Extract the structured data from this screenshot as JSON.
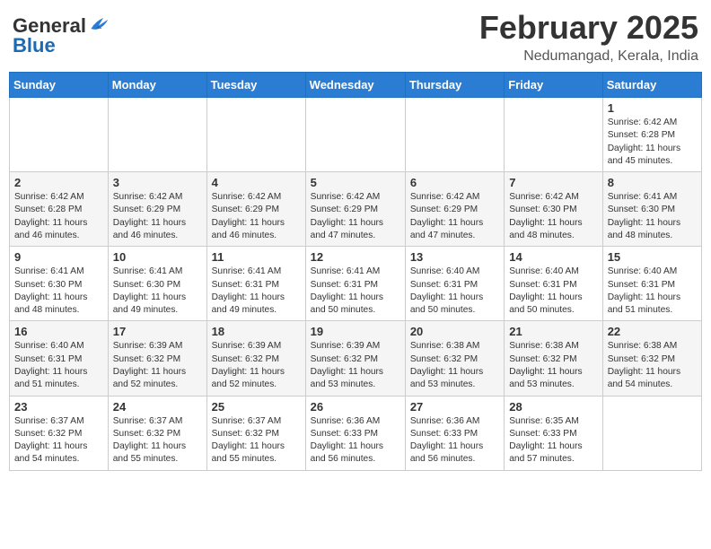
{
  "header": {
    "logo": {
      "general": "General",
      "blue": "Blue"
    },
    "title": "February 2025",
    "location": "Nedumangad, Kerala, India"
  },
  "weekdays": [
    "Sunday",
    "Monday",
    "Tuesday",
    "Wednesday",
    "Thursday",
    "Friday",
    "Saturday"
  ],
  "weeks": [
    [
      {
        "day": "",
        "info": ""
      },
      {
        "day": "",
        "info": ""
      },
      {
        "day": "",
        "info": ""
      },
      {
        "day": "",
        "info": ""
      },
      {
        "day": "",
        "info": ""
      },
      {
        "day": "",
        "info": ""
      },
      {
        "day": "1",
        "info": "Sunrise: 6:42 AM\nSunset: 6:28 PM\nDaylight: 11 hours\nand 45 minutes."
      }
    ],
    [
      {
        "day": "2",
        "info": "Sunrise: 6:42 AM\nSunset: 6:28 PM\nDaylight: 11 hours\nand 46 minutes."
      },
      {
        "day": "3",
        "info": "Sunrise: 6:42 AM\nSunset: 6:29 PM\nDaylight: 11 hours\nand 46 minutes."
      },
      {
        "day": "4",
        "info": "Sunrise: 6:42 AM\nSunset: 6:29 PM\nDaylight: 11 hours\nand 46 minutes."
      },
      {
        "day": "5",
        "info": "Sunrise: 6:42 AM\nSunset: 6:29 PM\nDaylight: 11 hours\nand 47 minutes."
      },
      {
        "day": "6",
        "info": "Sunrise: 6:42 AM\nSunset: 6:29 PM\nDaylight: 11 hours\nand 47 minutes."
      },
      {
        "day": "7",
        "info": "Sunrise: 6:42 AM\nSunset: 6:30 PM\nDaylight: 11 hours\nand 48 minutes."
      },
      {
        "day": "8",
        "info": "Sunrise: 6:41 AM\nSunset: 6:30 PM\nDaylight: 11 hours\nand 48 minutes."
      }
    ],
    [
      {
        "day": "9",
        "info": "Sunrise: 6:41 AM\nSunset: 6:30 PM\nDaylight: 11 hours\nand 48 minutes."
      },
      {
        "day": "10",
        "info": "Sunrise: 6:41 AM\nSunset: 6:30 PM\nDaylight: 11 hours\nand 49 minutes."
      },
      {
        "day": "11",
        "info": "Sunrise: 6:41 AM\nSunset: 6:31 PM\nDaylight: 11 hours\nand 49 minutes."
      },
      {
        "day": "12",
        "info": "Sunrise: 6:41 AM\nSunset: 6:31 PM\nDaylight: 11 hours\nand 50 minutes."
      },
      {
        "day": "13",
        "info": "Sunrise: 6:40 AM\nSunset: 6:31 PM\nDaylight: 11 hours\nand 50 minutes."
      },
      {
        "day": "14",
        "info": "Sunrise: 6:40 AM\nSunset: 6:31 PM\nDaylight: 11 hours\nand 50 minutes."
      },
      {
        "day": "15",
        "info": "Sunrise: 6:40 AM\nSunset: 6:31 PM\nDaylight: 11 hours\nand 51 minutes."
      }
    ],
    [
      {
        "day": "16",
        "info": "Sunrise: 6:40 AM\nSunset: 6:31 PM\nDaylight: 11 hours\nand 51 minutes."
      },
      {
        "day": "17",
        "info": "Sunrise: 6:39 AM\nSunset: 6:32 PM\nDaylight: 11 hours\nand 52 minutes."
      },
      {
        "day": "18",
        "info": "Sunrise: 6:39 AM\nSunset: 6:32 PM\nDaylight: 11 hours\nand 52 minutes."
      },
      {
        "day": "19",
        "info": "Sunrise: 6:39 AM\nSunset: 6:32 PM\nDaylight: 11 hours\nand 53 minutes."
      },
      {
        "day": "20",
        "info": "Sunrise: 6:38 AM\nSunset: 6:32 PM\nDaylight: 11 hours\nand 53 minutes."
      },
      {
        "day": "21",
        "info": "Sunrise: 6:38 AM\nSunset: 6:32 PM\nDaylight: 11 hours\nand 53 minutes."
      },
      {
        "day": "22",
        "info": "Sunrise: 6:38 AM\nSunset: 6:32 PM\nDaylight: 11 hours\nand 54 minutes."
      }
    ],
    [
      {
        "day": "23",
        "info": "Sunrise: 6:37 AM\nSunset: 6:32 PM\nDaylight: 11 hours\nand 54 minutes."
      },
      {
        "day": "24",
        "info": "Sunrise: 6:37 AM\nSunset: 6:32 PM\nDaylight: 11 hours\nand 55 minutes."
      },
      {
        "day": "25",
        "info": "Sunrise: 6:37 AM\nSunset: 6:32 PM\nDaylight: 11 hours\nand 55 minutes."
      },
      {
        "day": "26",
        "info": "Sunrise: 6:36 AM\nSunset: 6:33 PM\nDaylight: 11 hours\nand 56 minutes."
      },
      {
        "day": "27",
        "info": "Sunrise: 6:36 AM\nSunset: 6:33 PM\nDaylight: 11 hours\nand 56 minutes."
      },
      {
        "day": "28",
        "info": "Sunrise: 6:35 AM\nSunset: 6:33 PM\nDaylight: 11 hours\nand 57 minutes."
      },
      {
        "day": "",
        "info": ""
      }
    ]
  ]
}
